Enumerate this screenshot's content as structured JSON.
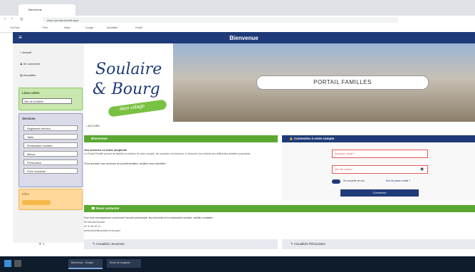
{
  "browser": {
    "tab_title": "Bienvenue",
    "url": "https://portail-famille.app/",
    "bookmarks": [
      "YouTube",
      "Plan",
      "Maps",
      "Google",
      "Actualités",
      "Portail"
    ]
  },
  "header": {
    "title": "Bienvenue"
  },
  "sidebar": {
    "nav": [
      "Accueil",
      "Se connecter",
      "Actualités"
    ],
    "useful_links_title": "Liens utiles",
    "useful_links_item": "Site de la Mairie",
    "services_title": "Services",
    "services": [
      "Règlement intérieur",
      "Tarifs",
      "Restauration scolaire",
      "Menus",
      "Périscolaire",
      "Point Jeunesse"
    ],
    "orange_title": "Infos"
  },
  "banner": {
    "logo_line1": "Soulaire",
    "logo_line2": "& Bourg",
    "logo_tagline": "Mon village",
    "portal_label": "PORTAIL FAMILLES"
  },
  "breadcrumb": "ACCUEIL",
  "welcome": {
    "title": "Bienvenue",
    "text1": "Vos services en toute simplicité",
    "text2": "Le Portail Famille permet de faciliter la création de votre compte, de consulter vos factures, et d'inscrire vos enfants aux différentes activités proposées.",
    "text3": "Pour accéder aux services du portail familles, veuillez vous identifier."
  },
  "login": {
    "title": "Connexion à votre compte",
    "email_placeholder": "Adresse email *",
    "password_placeholder": "Mot de passe *",
    "remember": "Se souvenir de moi",
    "forgot": "Mot de passe oublié ?",
    "submit": "Connexion"
  },
  "contact": {
    "title": "Nous contacter",
    "text": "Pour tout renseignement concernant l'accueil périscolaire, les mercredis et la restauration scolaire, veuillez contacter :",
    "name": "Mr Nicolas Bouvier",
    "phone": "02 41 82 81 11",
    "email": "periscolaire@soulaire-et-bourg.fr"
  },
  "news": {
    "left": "Actualités Jeunesse",
    "right": "Actualités Périscolaire"
  },
  "taskbar": {
    "items": [
      "Bienvenue - Google",
      "Écrire de la glance"
    ]
  }
}
